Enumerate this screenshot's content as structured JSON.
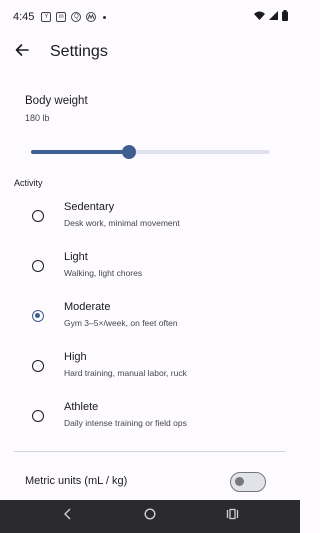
{
  "status_bar": {
    "time": "4:45",
    "notification_icons": [
      "Y",
      "in",
      "Q"
    ]
  },
  "app_bar": {
    "title": "Settings"
  },
  "body_weight": {
    "label": "Body weight",
    "value": "180 lb",
    "slider_fraction": 0.41
  },
  "activity": {
    "header": "Activity",
    "selected_index": 2,
    "options": [
      {
        "title": "Sedentary",
        "description": "Desk work, minimal movement"
      },
      {
        "title": "Light",
        "description": "Walking, light chores"
      },
      {
        "title": "Moderate",
        "description": "Gym 3–5×/week, on feet often"
      },
      {
        "title": "High",
        "description": "Hard training, manual labor, ruck"
      },
      {
        "title": "Athlete",
        "description": "Daily intense training or field ops"
      }
    ]
  },
  "metric_units": {
    "label": "Metric units (mL / kg)",
    "enabled": false
  },
  "colors": {
    "accent": "#3f5f91",
    "background": "#fdfbff",
    "nav_bar": "#2b2b2d"
  },
  "icons": {
    "back": "arrow-left-icon",
    "wifi": "wifi-icon",
    "signal": "signal-icon",
    "battery": "battery-icon",
    "nav_back": "chevron-left-icon",
    "nav_home": "circle-home-icon",
    "nav_recents": "recents-icon"
  }
}
